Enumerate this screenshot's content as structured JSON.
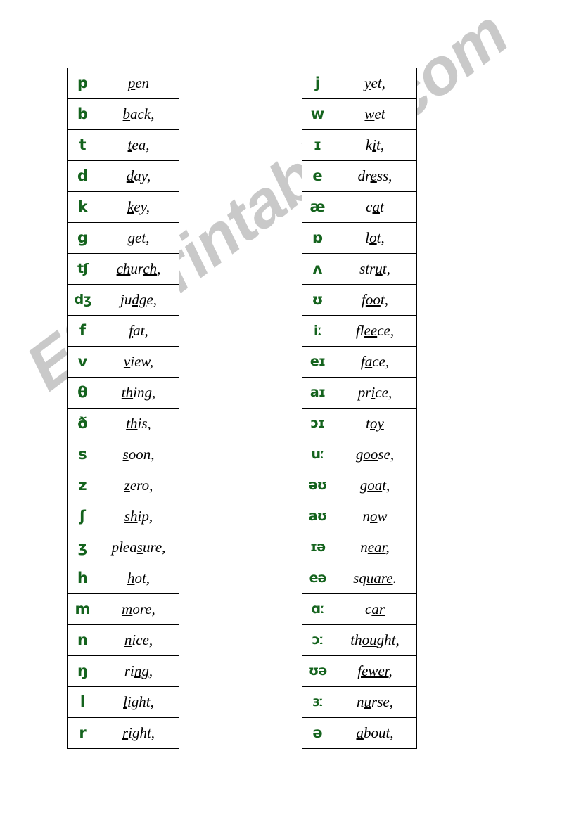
{
  "watermark": {
    "text": "ESLprintables.com",
    "color": "#c9c9c9"
  },
  "symbol_color": "#14631d",
  "border_color": "#000000",
  "consonants": {
    "name": "consonant-table",
    "rows": [
      {
        "symbol": "p",
        "word_pre": "",
        "word_mark": "p",
        "word_post": "en"
      },
      {
        "symbol": "b",
        "word_pre": "",
        "word_mark": "b",
        "word_post": "ack,"
      },
      {
        "symbol": "t",
        "word_pre": "",
        "word_mark": "t",
        "word_post": "ea,"
      },
      {
        "symbol": "d",
        "word_pre": "",
        "word_mark": "d",
        "word_post": "ay,"
      },
      {
        "symbol": "k",
        "word_pre": "",
        "word_mark": "k",
        "word_post": "ey,"
      },
      {
        "symbol": "g",
        "word_pre": "",
        "word_mark": "",
        "word_post": "get,"
      },
      {
        "symbol": "tʃ",
        "word_pre": "",
        "word_mark": "ch",
        "word_post": "ur",
        "word_mark2": "ch",
        "word_post2": ","
      },
      {
        "symbol": "dʒ",
        "word_pre": "ju",
        "word_mark": "dg",
        "word_post": "e,"
      },
      {
        "symbol": "f",
        "word_pre": "",
        "word_mark": "f",
        "word_post": "at,"
      },
      {
        "symbol": "v",
        "word_pre": "",
        "word_mark": "v",
        "word_post": "iew,"
      },
      {
        "symbol": "θ",
        "word_pre": "",
        "word_mark": "th",
        "word_post": "ing,"
      },
      {
        "symbol": "ð",
        "word_pre": "",
        "word_mark": "th",
        "word_post": "is,"
      },
      {
        "symbol": "s",
        "word_pre": "",
        "word_mark": "s",
        "word_post": "oon,"
      },
      {
        "symbol": "z",
        "word_pre": "",
        "word_mark": "z",
        "word_post": "ero,"
      },
      {
        "symbol": "ʃ",
        "word_pre": "",
        "word_mark": "sh",
        "word_post": "ip,"
      },
      {
        "symbol": "ʒ",
        "word_pre": "plea",
        "word_mark": "s",
        "word_post": "ure,"
      },
      {
        "symbol": "h",
        "word_pre": "",
        "word_mark": "h",
        "word_post": "ot,"
      },
      {
        "symbol": "m",
        "word_pre": "",
        "word_mark": "m",
        "word_post": "ore,"
      },
      {
        "symbol": "n",
        "word_pre": "",
        "word_mark": "n",
        "word_post": "ice,"
      },
      {
        "symbol": "ŋ",
        "word_pre": "ri",
        "word_mark": "ng",
        "word_post": ","
      },
      {
        "symbol": "l",
        "word_pre": "",
        "word_mark": "l",
        "word_post": "ight,"
      },
      {
        "symbol": "r",
        "word_pre": "",
        "word_mark": "r",
        "word_post": "ight,"
      }
    ]
  },
  "vowels": {
    "name": "vowel-table",
    "rows": [
      {
        "symbol": "j",
        "wide": true,
        "word_pre": "",
        "word_mark": "y",
        "word_post": "et,"
      },
      {
        "symbol": "w",
        "wide": true,
        "word_pre": "",
        "word_mark": "w",
        "word_post": "et"
      },
      {
        "symbol": "ɪ",
        "wide": false,
        "word_pre": "k",
        "word_mark": "i",
        "word_post": "t,"
      },
      {
        "symbol": "e",
        "wide": false,
        "word_pre": "dr",
        "word_mark": "e",
        "word_post": "ss,"
      },
      {
        "symbol": "æ",
        "wide": false,
        "word_pre": "c",
        "word_mark": "a",
        "word_post": "t"
      },
      {
        "symbol": "ɒ",
        "wide": false,
        "word_pre": "l",
        "word_mark": "o",
        "word_post": "t,"
      },
      {
        "symbol": "ʌ",
        "wide": false,
        "word_pre": "str",
        "word_mark": "u",
        "word_post": "t,"
      },
      {
        "symbol": "ʊ",
        "wide": false,
        "word_pre": "f",
        "word_mark": "oo",
        "word_post": "t,"
      },
      {
        "symbol": "iː",
        "wide": false,
        "word_pre": "fl",
        "word_mark": "ee",
        "word_post": "ce,"
      },
      {
        "symbol": "eɪ",
        "wide": false,
        "word_pre": "f",
        "word_mark": "a",
        "word_post": "ce,"
      },
      {
        "symbol": "aɪ",
        "wide": false,
        "word_pre": "pr",
        "word_mark": "i",
        "word_post": "ce,"
      },
      {
        "symbol": "ɔɪ",
        "wide": false,
        "word_pre": "t",
        "word_mark": "oy",
        "word_post": ""
      },
      {
        "symbol": "uː",
        "wide": false,
        "word_pre": "g",
        "word_mark": "oo",
        "word_post": "se,"
      },
      {
        "symbol": "əʊ",
        "wide": false,
        "word_pre": "g",
        "word_mark": "oa",
        "word_post": "t,"
      },
      {
        "symbol": "aʊ",
        "wide": false,
        "word_pre": "n",
        "word_mark": "o",
        "word_post": "w"
      },
      {
        "symbol": "ɪə",
        "wide": false,
        "word_pre": "n",
        "word_mark": "ear",
        "word_post": ","
      },
      {
        "symbol": "eə",
        "wide": false,
        "word_pre": "sq",
        "word_mark": "uare",
        "word_post": "."
      },
      {
        "symbol": "ɑː",
        "wide": false,
        "word_pre": "c",
        "word_mark": "ar",
        "word_post": ""
      },
      {
        "symbol": "ɔː",
        "wide": false,
        "word_pre": "th",
        "word_mark": "ou",
        "word_post": "ght,"
      },
      {
        "symbol": "ʊə",
        "wide": false,
        "word_pre": "",
        "word_mark": "fewer",
        "word_post": ","
      },
      {
        "symbol": "ɜː",
        "wide": false,
        "word_pre": "n",
        "word_mark": "u",
        "word_post": "rse,"
      },
      {
        "symbol": "ə",
        "wide": false,
        "word_pre": "",
        "word_mark": "a",
        "word_post": "bout,"
      }
    ]
  }
}
